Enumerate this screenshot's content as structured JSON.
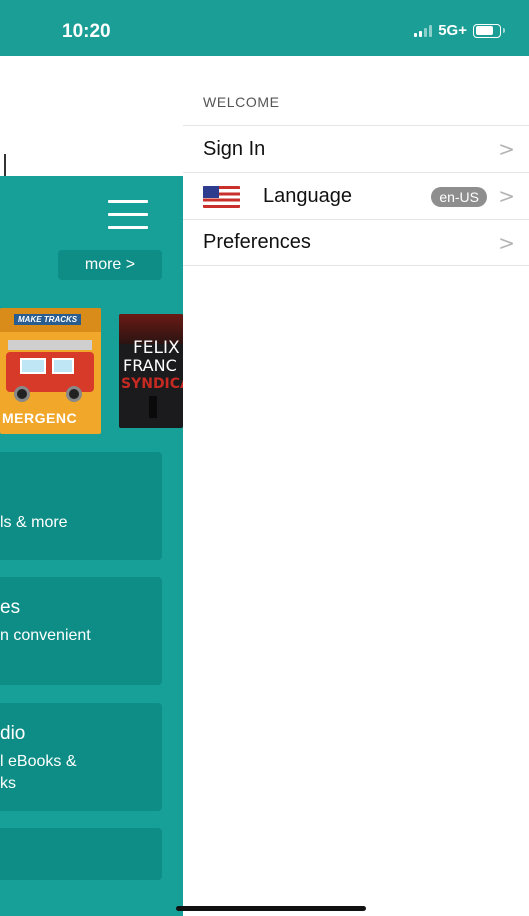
{
  "status_bar": {
    "time": "10:20",
    "network": "5G+",
    "signal_icon": "signal-bars-icon",
    "battery_icon": "battery-icon",
    "battery_level": 0.76,
    "background": "#1a9e96"
  },
  "background_app": {
    "menu_icon": "hamburger-menu-icon",
    "more_button_label": "more >",
    "books": [
      {
        "band_text": "MAKE TRACKS",
        "cover_text": "MERGENC"
      },
      {
        "title_line1": "FELIX",
        "title_line2": "FRANC",
        "title_line3": "SYNDICA"
      }
    ],
    "cards": [
      {
        "title": "",
        "subtitle": "ls & more"
      },
      {
        "title": "es",
        "subtitle": "n convenient"
      },
      {
        "title": "dio",
        "subtitle_line1": "l eBooks &",
        "subtitle_line2": "ks"
      },
      {
        "title": "",
        "subtitle": ""
      }
    ],
    "accent_color": "#17a097",
    "card_color": "#0e8d86"
  },
  "drawer": {
    "section_header": "WELCOME",
    "items": [
      {
        "label": "Sign In",
        "chevron": ">"
      },
      {
        "label": "Language",
        "badge": "en-US",
        "flag_icon": "us-flag-icon",
        "chevron": ">"
      },
      {
        "label": "Preferences",
        "chevron": ">"
      }
    ]
  }
}
